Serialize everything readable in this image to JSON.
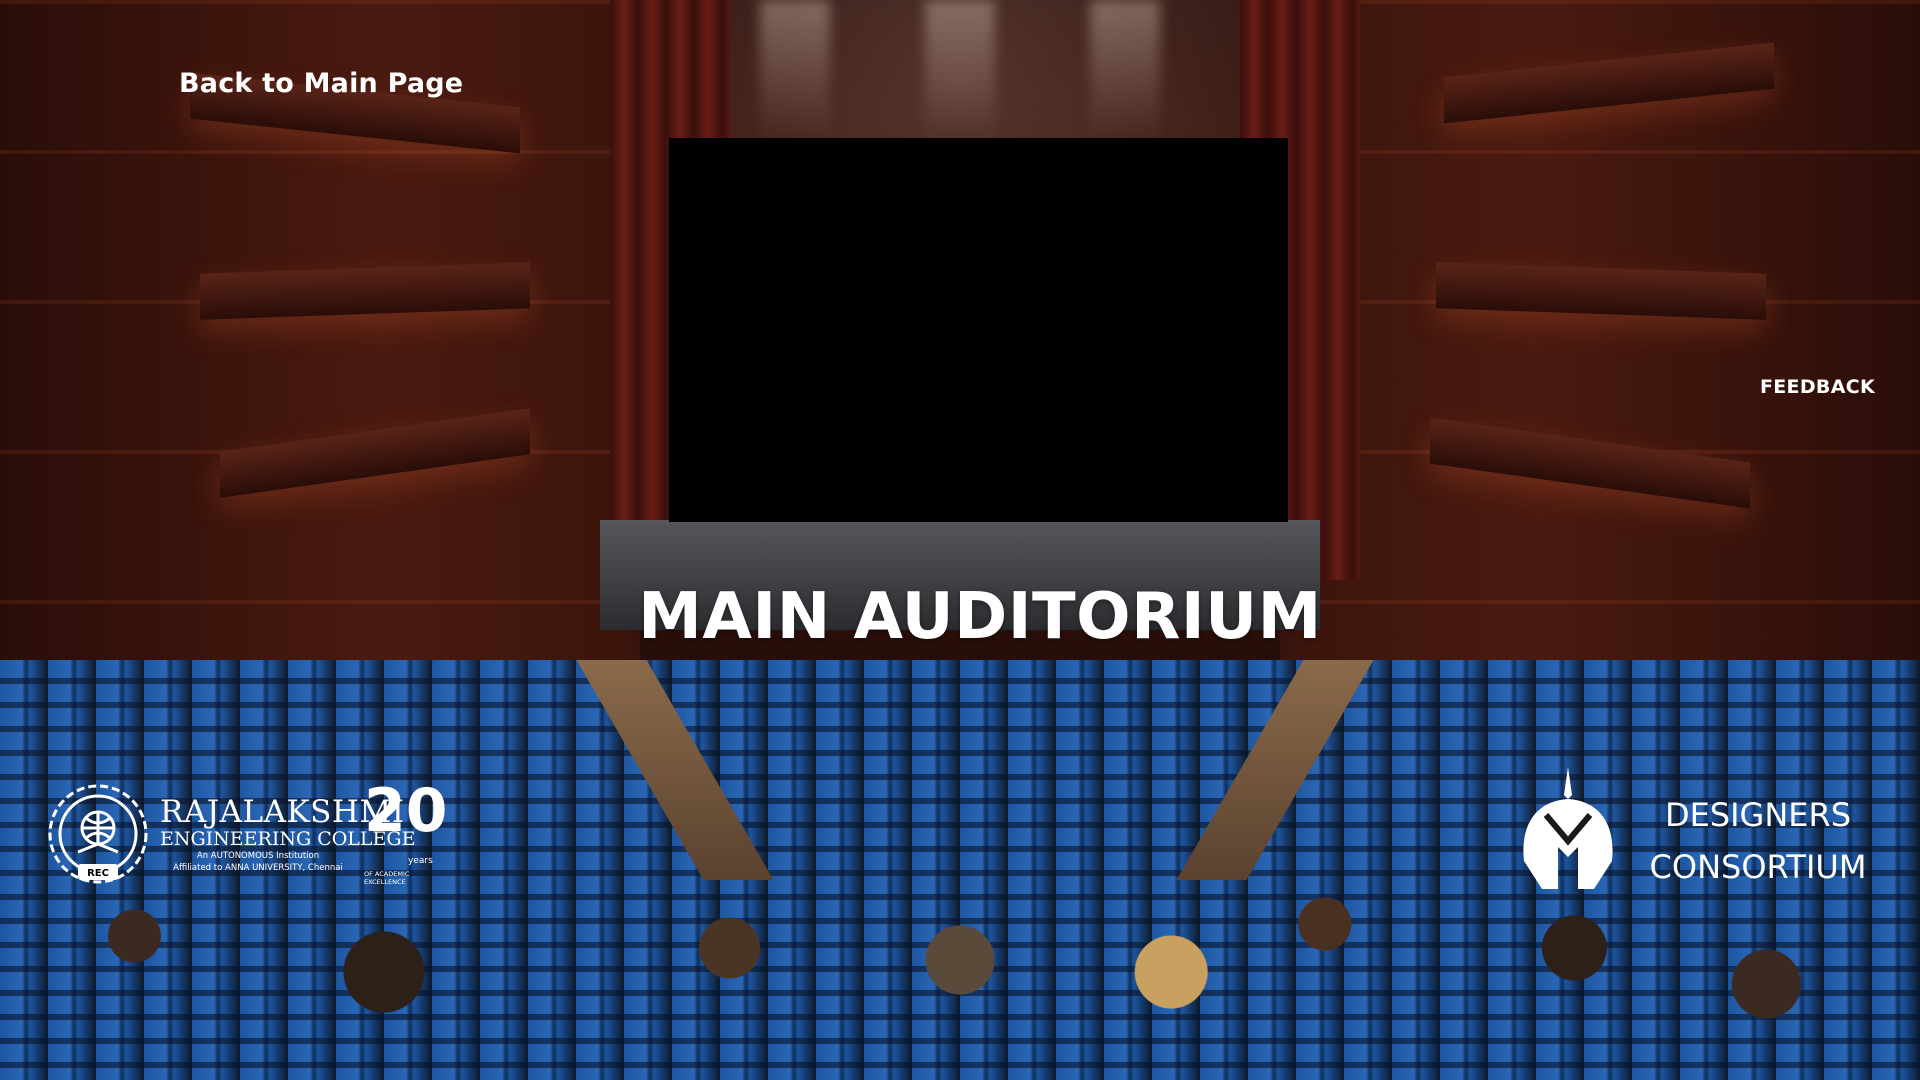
{
  "nav": {
    "back_label": "Back to Main Page",
    "feedback_label": "FEEDBACK"
  },
  "auditorium": {
    "title": "MAIN AUDITORIUM",
    "screen_state": "blank"
  },
  "logos": {
    "rec": {
      "name": "RAJALAKSHMI",
      "subname": "ENGINEERING COLLEGE",
      "tagline1": "An AUTONOMOUS Institution",
      "tagline2": "Affiliated to ANNA UNIVERSITY, Chennai",
      "years_number": "20",
      "years_word": "years",
      "years_tagline": "OF ACADEMIC EXCELLENCE",
      "emblem_text": "REC"
    },
    "designers": {
      "line1": "DESIGNERS",
      "line2": "CONSORTIUM"
    }
  },
  "colors": {
    "text": "#ffffff",
    "seat_blue": "#1e5aa8",
    "wall_red": "#4a1a10",
    "screen": "#000000"
  }
}
